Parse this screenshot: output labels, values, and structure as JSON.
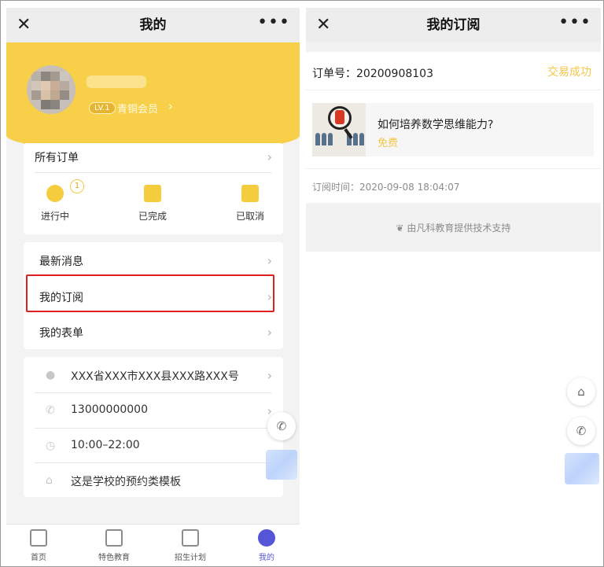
{
  "left": {
    "nav": {
      "close": "✕",
      "title": "我的",
      "more": "•••"
    },
    "profile": {
      "level": "LV.1",
      "member": "青铜会员"
    },
    "orders": {
      "title": "所有订单",
      "items": [
        {
          "label": "进行中",
          "badge": "1"
        },
        {
          "label": "已完成"
        },
        {
          "label": "已取消"
        }
      ]
    },
    "menu": [
      "最新消息",
      "我的订阅",
      "我的表单"
    ],
    "info": {
      "address": "XXX省XXX市XXX县XXX路XXX号",
      "phone": "13000000000",
      "hours": "10:00–22:00",
      "note": "这是学校的预约类模板"
    },
    "tabs": [
      "首页",
      "特色教育",
      "招生计划",
      "我的"
    ]
  },
  "right": {
    "nav": {
      "close": "✕",
      "title": "我的订阅",
      "more": "•••"
    },
    "order_no_label": "订单号：",
    "order_no": "20200908103",
    "status": "交易成功",
    "product": {
      "title": "如何培养数学思维能力?",
      "price": "免费"
    },
    "sub_time_label": "订阅时间：",
    "sub_time": "2020-09-08 18:04:07",
    "support": "由凡科教育提供技术支持"
  },
  "colors": {
    "accent_yellow": "#f7cf48",
    "highlight_red": "#e02020",
    "tab_active": "#5555d8",
    "status_yellow": "#f4c64a"
  }
}
